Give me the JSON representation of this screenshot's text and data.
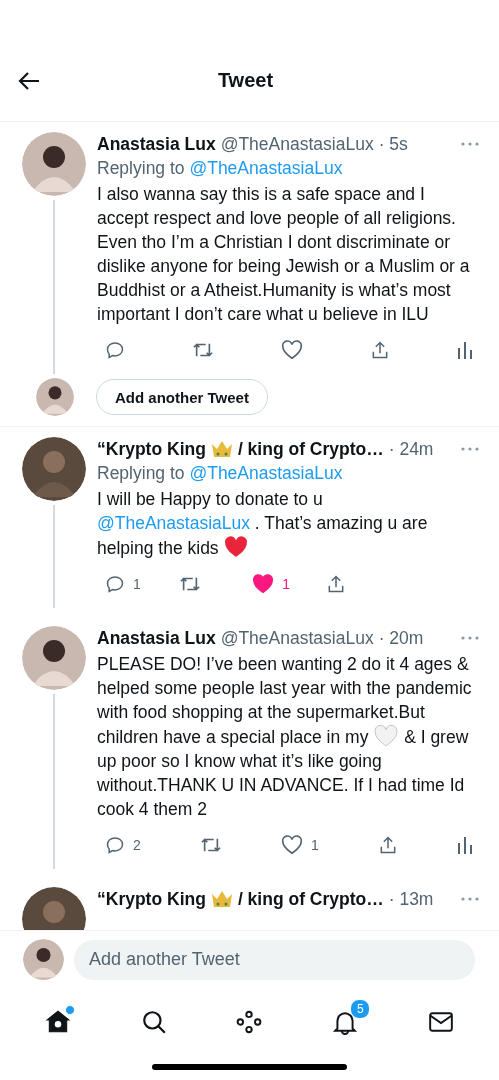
{
  "header": {
    "title": "Tweet"
  },
  "tweets": [
    {
      "name": [
        {
          "kind": "text",
          "text": "Anastasia Lux"
        }
      ],
      "handle": "@TheAnastasiaLux",
      "time": "· 5s",
      "replying_label": "Replying to",
      "replying_to": "@TheAnastasiaLux",
      "thread_below": true,
      "body": [
        {
          "kind": "text",
          "text": "I also wanna say this is a safe space and I accept respect and love people of all religions. Even tho I’m a Christian I dont discriminate or dislike anyone for being Jewish or a Muslim or a Buddhist or a Atheist.Humanity is what’s most important I don’t care what u believe in ILU"
        }
      ],
      "actions": [
        {
          "kind": "reply"
        },
        {
          "kind": "retweet"
        },
        {
          "kind": "like",
          "liked": false
        },
        {
          "kind": "share"
        },
        {
          "kind": "analytics"
        }
      ]
    },
    {
      "name": [
        {
          "kind": "text",
          "text": "“Krypto King"
        },
        {
          "kind": "crown"
        },
        {
          "kind": "text",
          "text": "/ king of Crypto…"
        }
      ],
      "time": "· 24m",
      "replying_label": "Replying to",
      "replying_to": "@TheAnastasiaLux",
      "thread_below": true,
      "body": [
        {
          "kind": "text",
          "text": "I will be Happy to donate to u "
        },
        {
          "kind": "mention",
          "text": "@TheAnastasiaLux"
        },
        {
          "kind": "text",
          "text": " .  That’s amazing u are helping the kids "
        },
        {
          "kind": "heart",
          "color": "#e8253a"
        }
      ],
      "actions": [
        {
          "kind": "reply",
          "count": "1"
        },
        {
          "kind": "retweet"
        },
        {
          "kind": "like",
          "liked": true,
          "count": "1"
        },
        {
          "kind": "share"
        }
      ]
    },
    {
      "name": [
        {
          "kind": "text",
          "text": "Anastasia Lux"
        }
      ],
      "handle": "@TheAnastasiaLux",
      "time": "· 20m",
      "thread_below": true,
      "body": [
        {
          "kind": "text",
          "text": "PLEASE DO! I’ve been wanting 2 do it 4 ages & helped some people last year with the pandemic with food shopping at the supermarket.But children have a special place in my "
        },
        {
          "kind": "heart",
          "color": "#f2f2f2"
        },
        {
          "kind": "text",
          "text": " & I grew up poor so I know what it’s like going without.THANK U IN ADVANCE. If I had time Id cook 4 them 2"
        }
      ],
      "actions": [
        {
          "kind": "reply",
          "count": "2"
        },
        {
          "kind": "retweet"
        },
        {
          "kind": "like",
          "liked": false,
          "count": "1"
        },
        {
          "kind": "share"
        },
        {
          "kind": "analytics"
        }
      ]
    },
    {
      "name": [
        {
          "kind": "text",
          "text": "“Krypto King"
        },
        {
          "kind": "crown"
        },
        {
          "kind": "text",
          "text": "/ king of Crypto…"
        }
      ],
      "time": "· 13m",
      "thread_below": false
    }
  ],
  "reply_prompt": {
    "button": "Add another Tweet"
  },
  "composer": {
    "placeholder": "Add another Tweet"
  },
  "nav": [
    {
      "kind": "home",
      "selected": true,
      "dot": true
    },
    {
      "kind": "search",
      "selected": false
    },
    {
      "kind": "spaces",
      "selected": false
    },
    {
      "kind": "notifications",
      "selected": false,
      "badge": "5"
    },
    {
      "kind": "messages",
      "selected": false
    }
  ]
}
